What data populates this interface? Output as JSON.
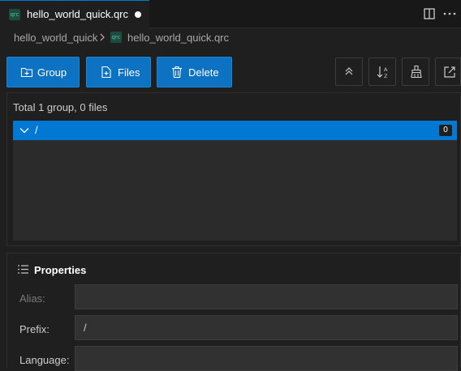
{
  "tab": {
    "title": "hello_world_quick.qrc",
    "icon_text": "qrc"
  },
  "breadcrumb": {
    "folder": "hello_world_quick",
    "file": "hello_world_quick.qrc"
  },
  "toolbar": {
    "group_label": "Group",
    "files_label": "Files",
    "delete_label": "Delete"
  },
  "tree": {
    "summary": "Total 1 group, 0 files",
    "rows": [
      {
        "name": "/",
        "count": "0"
      }
    ]
  },
  "properties": {
    "title": "Properties",
    "alias_label": "Alias:",
    "alias_value": "",
    "prefix_label": "Prefix:",
    "prefix_value": "/",
    "language_label": "Language:",
    "language_value": ""
  },
  "colors": {
    "accent": "#0078d4",
    "button": "#0e72c3",
    "background": "#1f1f1f"
  }
}
